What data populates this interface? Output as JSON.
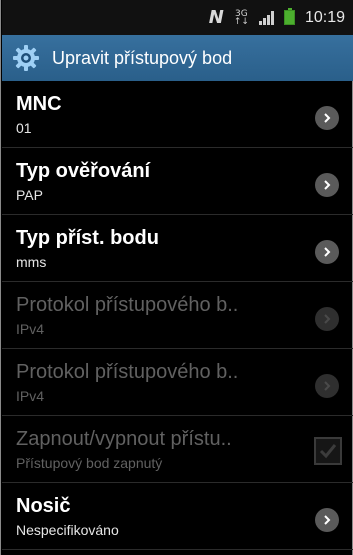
{
  "status_bar": {
    "carrier_glyph": "N",
    "network_top": "3G",
    "network_bottom": "↑↓",
    "time": "10:19"
  },
  "action_bar": {
    "icon": "gear-icon",
    "title": "Upravit přístupový bod"
  },
  "items": [
    {
      "title": "MNC",
      "summary": "01",
      "enabled": true,
      "control": "chevron"
    },
    {
      "title": "Typ ověřování",
      "summary": "PAP",
      "enabled": true,
      "control": "chevron"
    },
    {
      "title": "Typ příst. bodu",
      "summary": "mms",
      "enabled": true,
      "control": "chevron"
    },
    {
      "title": "Protokol přístupového b..",
      "summary": "IPv4",
      "enabled": false,
      "control": "chevron"
    },
    {
      "title": "Protokol přístupového b..",
      "summary": "IPv4",
      "enabled": false,
      "control": "chevron"
    },
    {
      "title": "Zapnout/vypnout přístu..",
      "summary": "Přístupový bod zapnutý",
      "enabled": false,
      "control": "checkbox",
      "checked": true
    },
    {
      "title": "Nosič",
      "summary": "Nespecifikováno",
      "enabled": true,
      "control": "chevron"
    }
  ],
  "colors": {
    "action_bar": "#2f6694",
    "battery": "#4caf2e",
    "disabled_text": "#616161"
  }
}
